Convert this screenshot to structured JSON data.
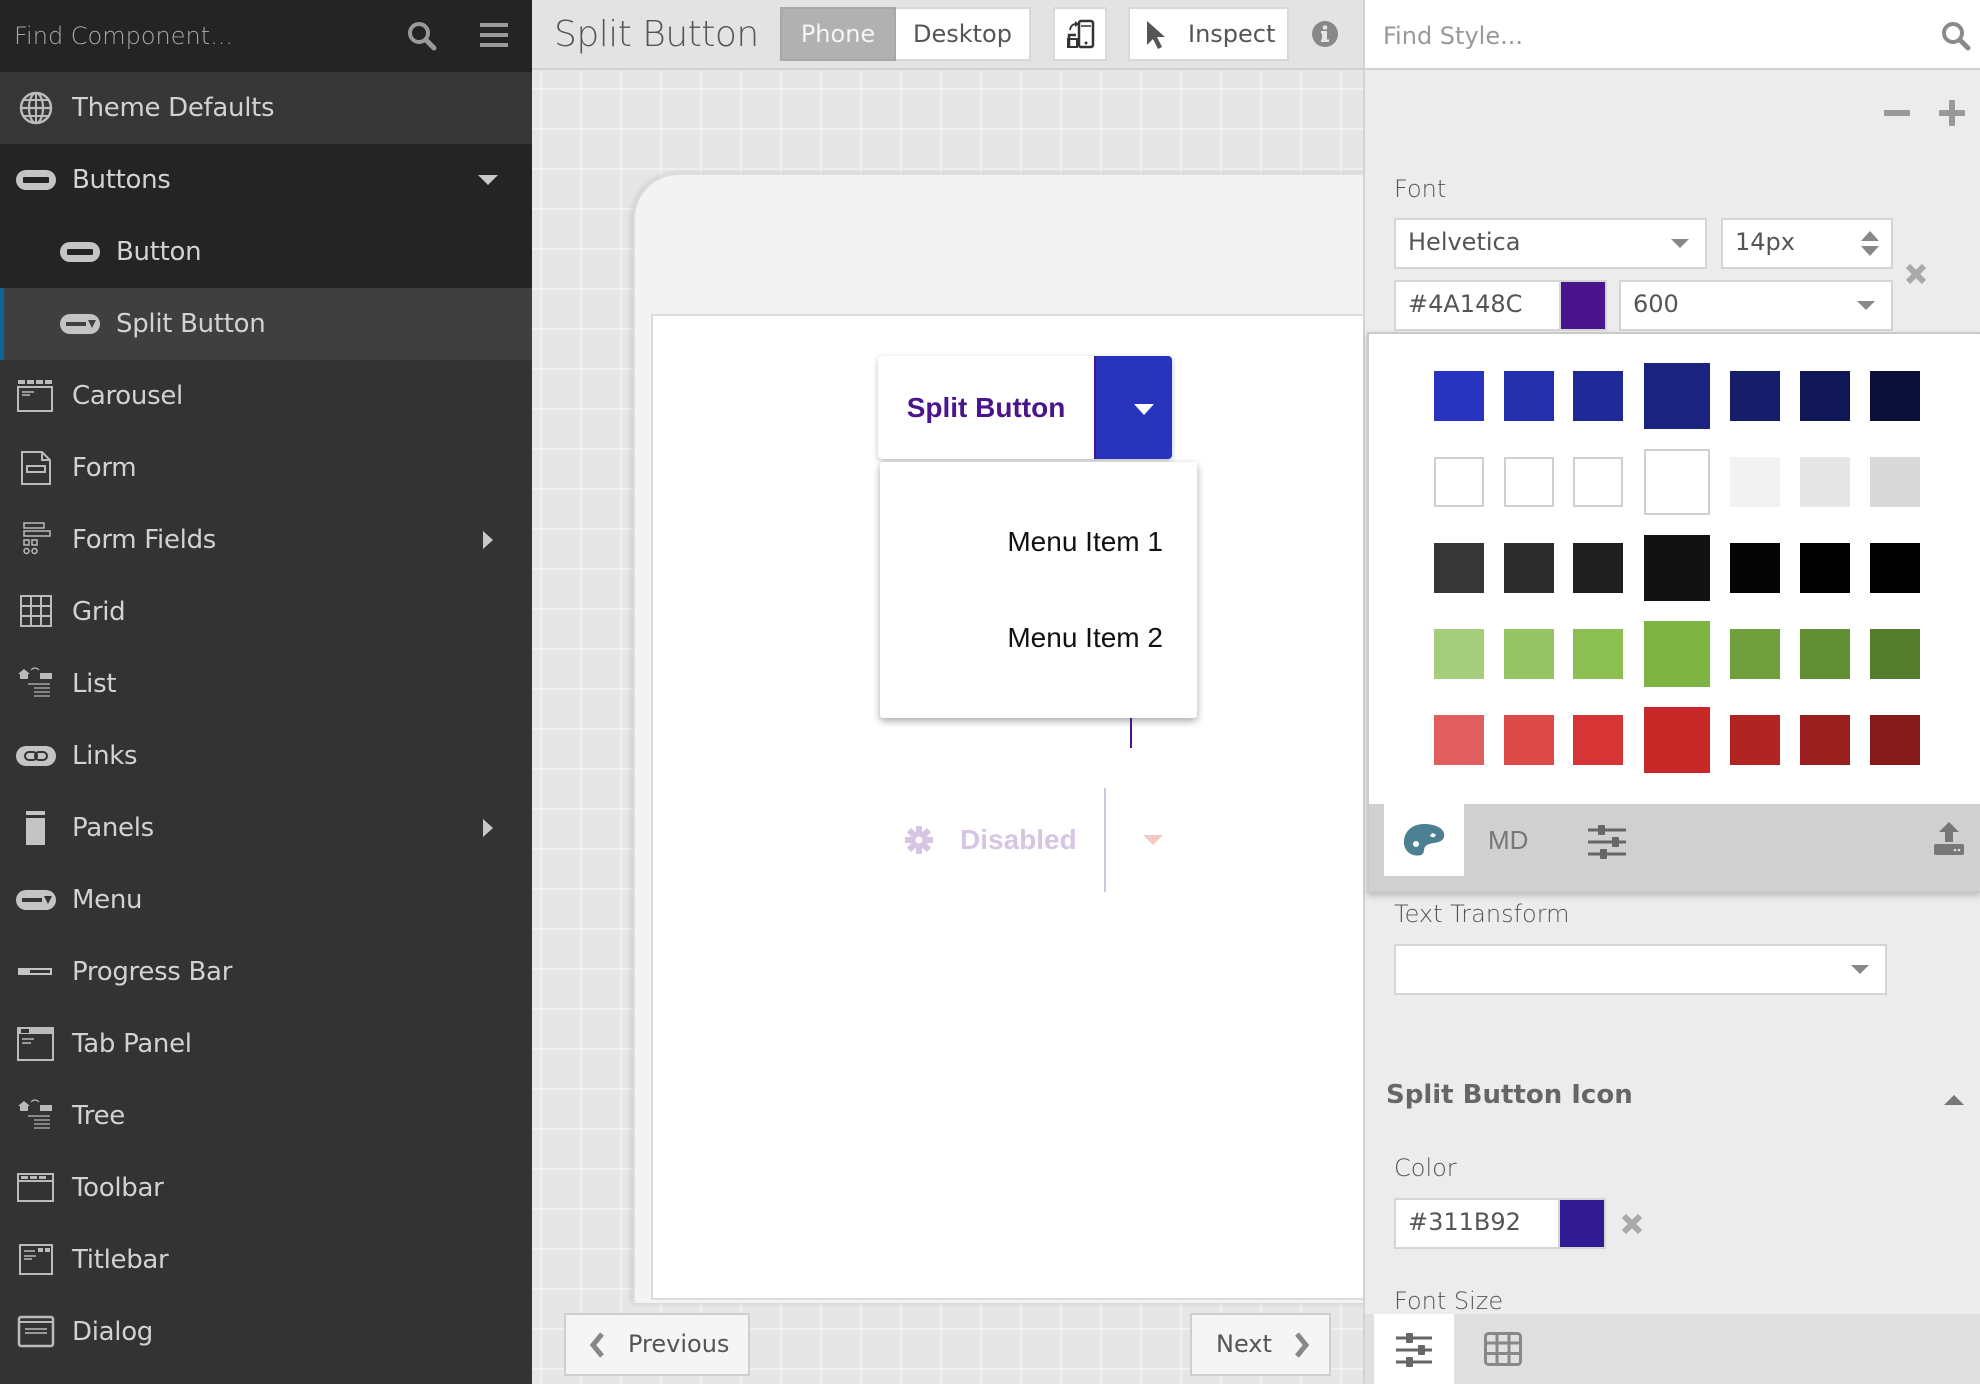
{
  "sidebar": {
    "search_placeholder": "Find Component...",
    "items": [
      {
        "label": "Theme Defaults",
        "icon": "globe-icon"
      },
      {
        "label": "Buttons",
        "icon": "button-icon",
        "expanded": true
      },
      {
        "label": "Button",
        "icon": "button-icon"
      },
      {
        "label": "Split Button",
        "icon": "split-button-icon",
        "selected": true
      },
      {
        "label": "Carousel",
        "icon": "carousel-icon"
      },
      {
        "label": "Form",
        "icon": "form-icon"
      },
      {
        "label": "Form Fields",
        "icon": "form-fields-icon",
        "has_children": true
      },
      {
        "label": "Grid",
        "icon": "grid-icon"
      },
      {
        "label": "List",
        "icon": "list-icon"
      },
      {
        "label": "Links",
        "icon": "link-icon"
      },
      {
        "label": "Panels",
        "icon": "panel-icon",
        "has_children": true
      },
      {
        "label": "Menu",
        "icon": "menu-button-icon"
      },
      {
        "label": "Progress Bar",
        "icon": "progress-bar-icon"
      },
      {
        "label": "Tab Panel",
        "icon": "tab-panel-icon"
      },
      {
        "label": "Tree",
        "icon": "tree-icon"
      },
      {
        "label": "Toolbar",
        "icon": "toolbar-icon"
      },
      {
        "label": "Titlebar",
        "icon": "titlebar-icon"
      },
      {
        "label": "Dialog",
        "icon": "dialog-icon"
      }
    ]
  },
  "toolbar": {
    "title": "Split Button",
    "phone_label": "Phone",
    "desktop_label": "Desktop",
    "inspect_label": "Inspect",
    "active_view": "Phone"
  },
  "preview": {
    "split_button_label": "Split Button",
    "menu_items": [
      "Menu Item 1",
      "Menu Item 2"
    ],
    "disabled_label": "Disabled",
    "prev_label": "Previous",
    "next_label": "Next"
  },
  "style_panel": {
    "search_placeholder": "Find Style...",
    "font_label": "Font",
    "font_family": "Helvetica",
    "font_size": "14px",
    "font_color": "#4A148C",
    "font_weight": "600",
    "text_transform_label": "Text Transform",
    "text_transform_value": "",
    "section_title": "Split Button Icon",
    "icon_color_label": "Color",
    "icon_color": "#311B92",
    "font_size_label": "Font Size",
    "picker_tabs": [
      "palette",
      "MD",
      "sliders"
    ],
    "picker_md_label": "MD",
    "swatches": [
      [
        "#2833c0",
        "#2430ab",
        "#1f2a98",
        "#1a237e",
        "#161e6a",
        "#111756",
        "#0c1038"
      ],
      [
        "#ffffff",
        "#ffffff",
        "#ffffff",
        "#ffffff",
        "#f2f2f2",
        "#e6e6e6",
        "#d9d9d9"
      ],
      [
        "#363636",
        "#2b2b2b",
        "#1f1f1f",
        "#121212",
        "#050505",
        "#000000",
        "#000000"
      ],
      [
        "#a5cd7b",
        "#96c465",
        "#8bbf52",
        "#7cb342",
        "#6fa03b",
        "#628e34",
        "#557b2d"
      ],
      [
        "#e05e5e",
        "#dc4949",
        "#d73535",
        "#c62828",
        "#b02424",
        "#9b1f1f",
        "#851b1b"
      ]
    ]
  },
  "colors": {
    "accent_blue": "#2834BC",
    "brand_purple": "#4A148C",
    "selection_bar": "#0F6591"
  }
}
